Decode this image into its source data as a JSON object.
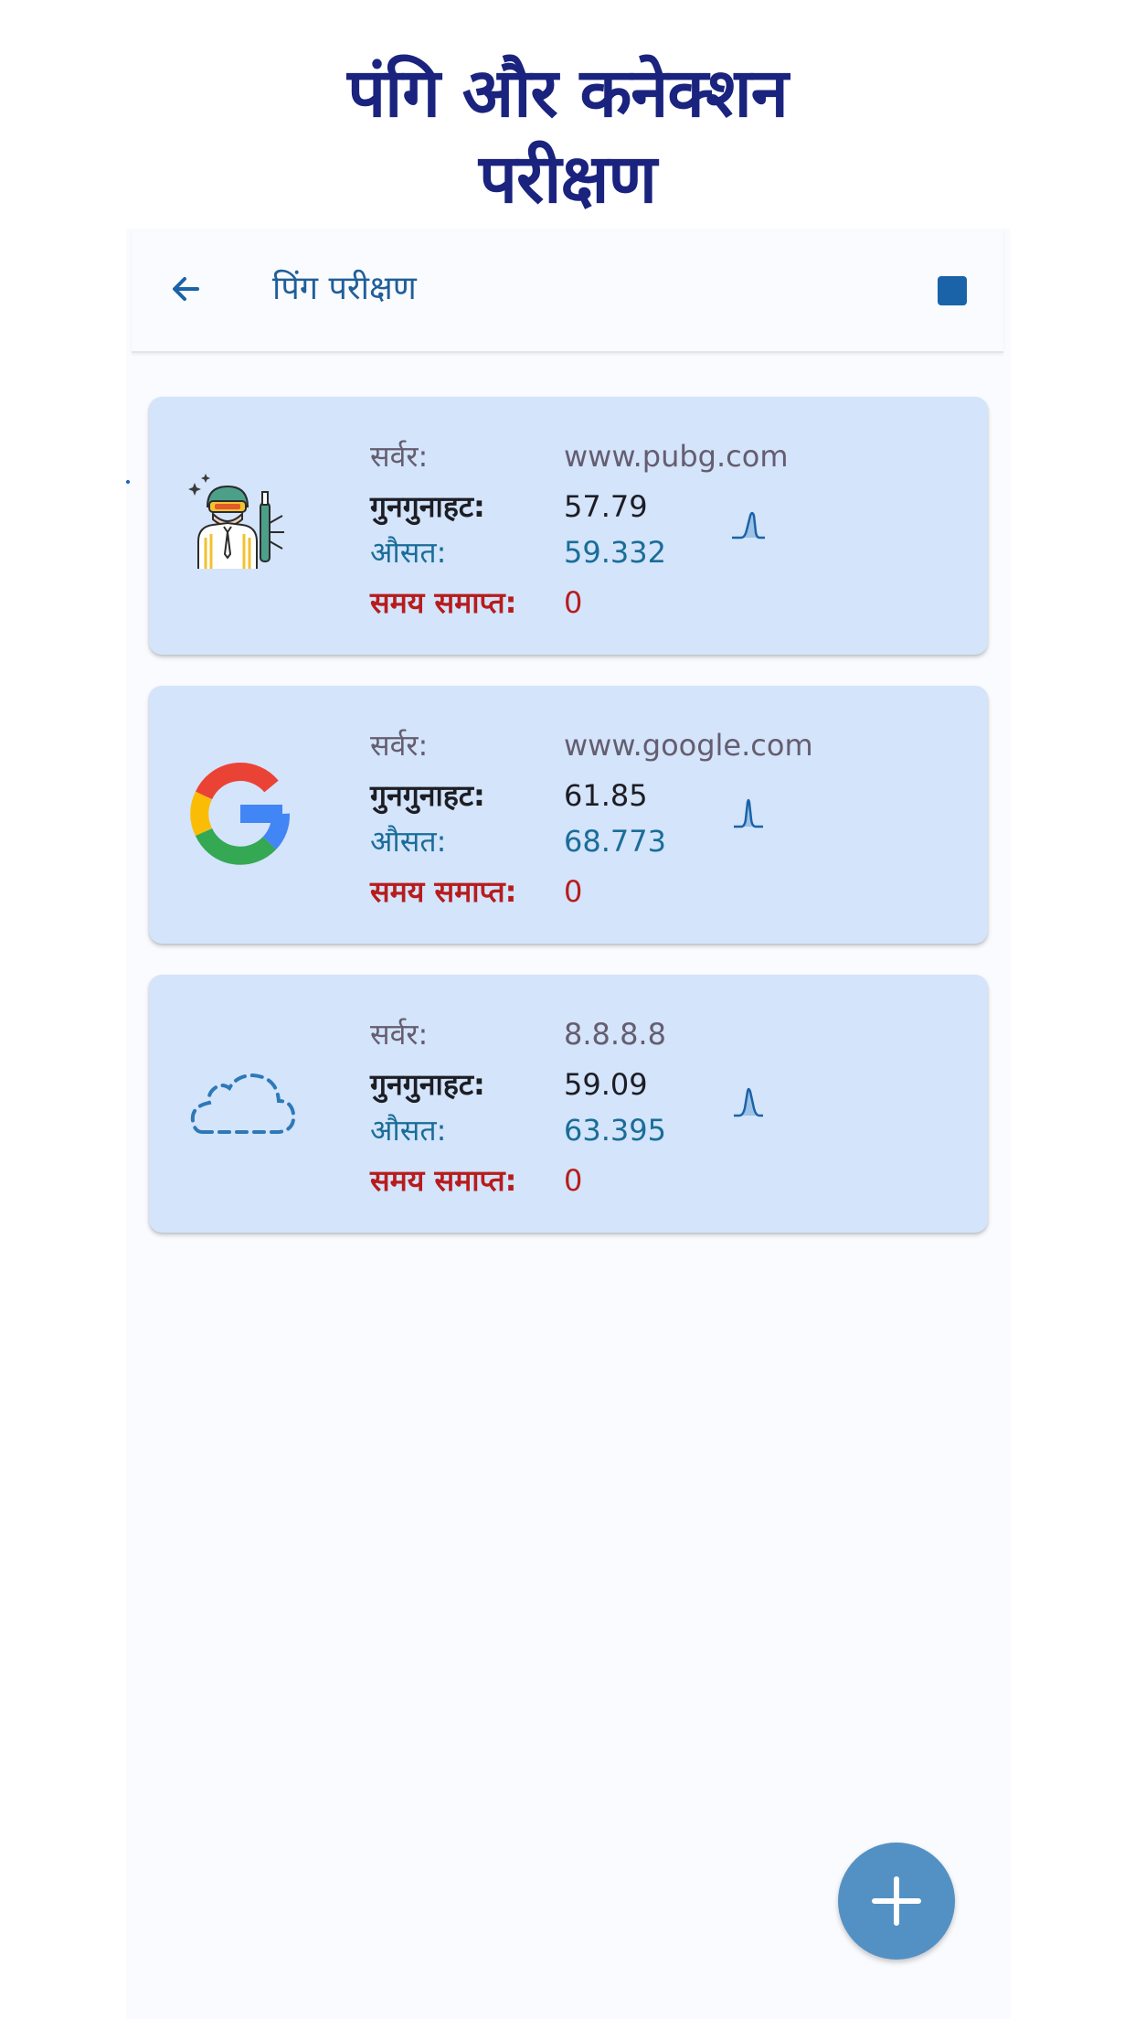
{
  "promo": {
    "title_line1": "पंगि और कनेक्शन",
    "title_line2": "परीक्षण"
  },
  "appbar": {
    "title": "पिंग परीक्षण",
    "back_icon": "arrow-left-icon",
    "stop_icon": "stop-square-icon"
  },
  "labels": {
    "server": "सर्वर:",
    "jitter": "गुनगुनाहट:",
    "average": "औसत:",
    "timeout": "समय समाप्त:"
  },
  "cards": [
    {
      "icon": "pubg-soldier-icon",
      "server": "www.pubg.com",
      "jitter": "57.79",
      "average": "59.332",
      "timeout": "0"
    },
    {
      "icon": "google-g-icon",
      "server": "www.google.com",
      "jitter": "61.85",
      "average": "68.773",
      "timeout": "0"
    },
    {
      "icon": "dashed-cloud-icon",
      "server": "8.8.8.8",
      "jitter": "59.09",
      "average": "63.395",
      "timeout": "0"
    }
  ],
  "fab": {
    "icon": "plus-icon"
  },
  "colors": {
    "title": "#1a237e",
    "appbar_title": "#1f5f9a",
    "card_bg": "#d3e4fb",
    "server_text": "#655d70",
    "average_text": "#1a6d98",
    "timeout_text": "#b71c1c",
    "fab": "#5391c4"
  }
}
